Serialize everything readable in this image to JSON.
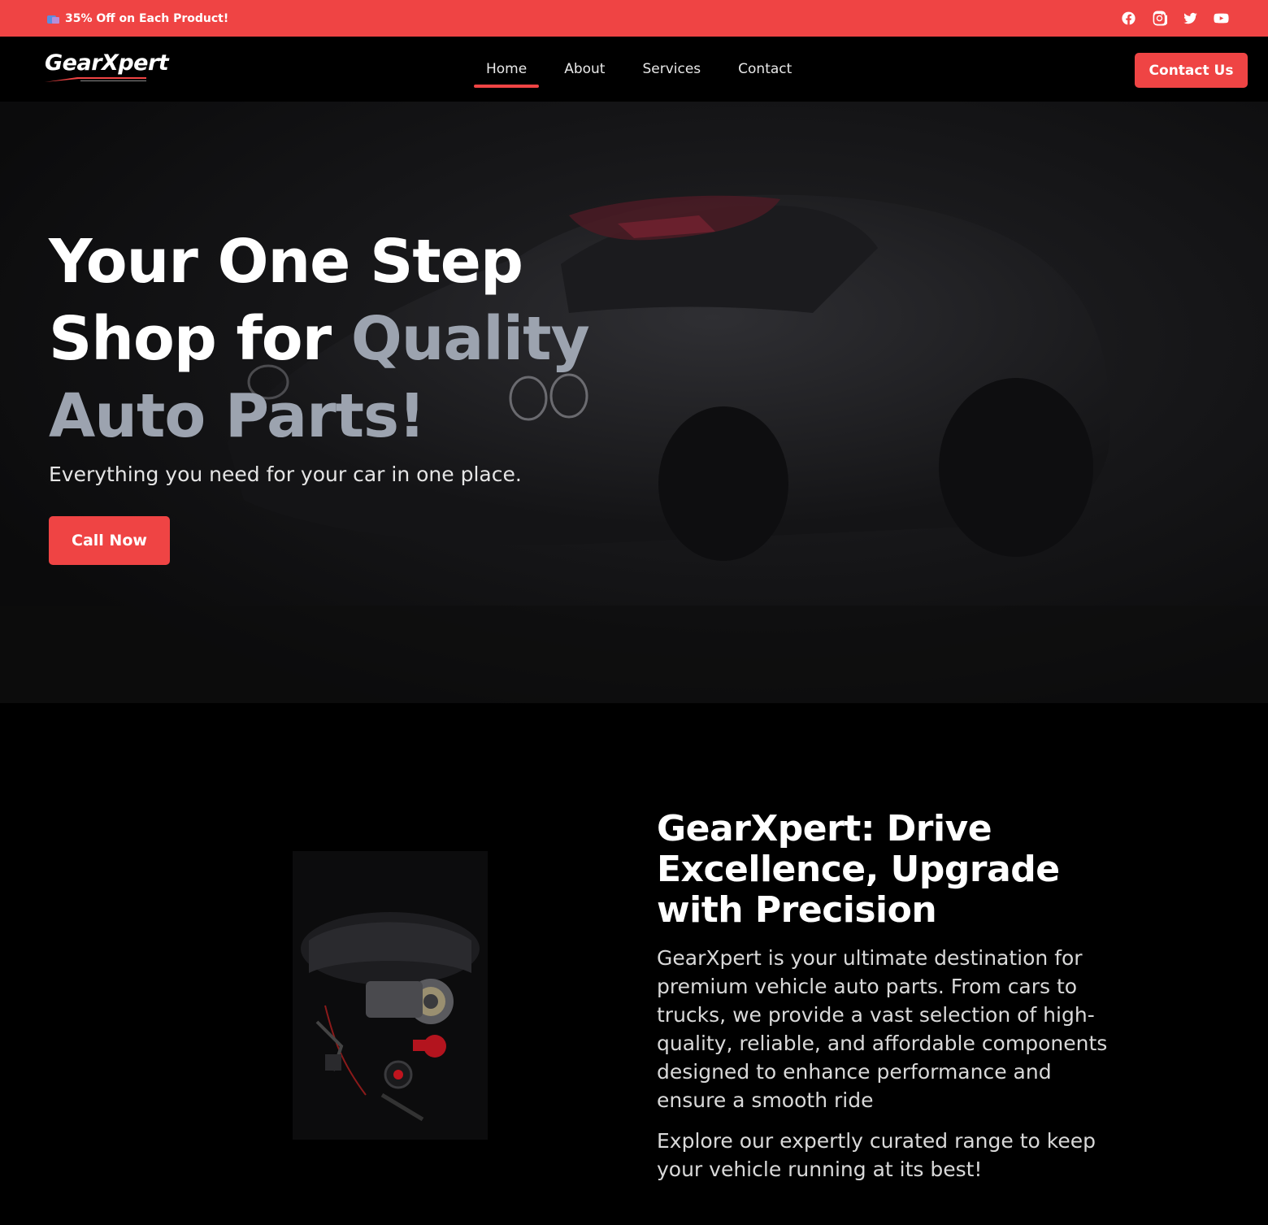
{
  "topbar": {
    "promo_text": "35% Off on Each Product!",
    "promo_icon": "shopping-bags-icon",
    "socials": [
      {
        "name": "facebook-icon"
      },
      {
        "name": "instagram-icon"
      },
      {
        "name": "twitter-icon"
      },
      {
        "name": "youtube-icon"
      }
    ]
  },
  "navbar": {
    "logo": "GearXpert",
    "items": [
      {
        "label": "Home",
        "active": true
      },
      {
        "label": "About"
      },
      {
        "label": "Services"
      },
      {
        "label": "Contact"
      }
    ],
    "cta_label": "Contact Us"
  },
  "hero": {
    "title_part1": "Your One Step Shop for",
    "title_accent": "Quality Auto Parts!",
    "subtitle": "Everything you need for your car in one place.",
    "button_label": "Call Now"
  },
  "about": {
    "title": "GearXpert: Drive Excellence, Upgrade with Precision",
    "paragraph1": "GearXpert is your ultimate destination for premium vehicle auto parts. From cars to trucks, we provide a vast selection of high-quality, reliable, and affordable components designed to enhance performance and ensure a smooth ride",
    "paragraph2": "Explore our expertly curated range to keep your vehicle running at its best!"
  },
  "colors": {
    "accent": "#ef4444",
    "accent_text": "#9ca3af",
    "background": "#000000"
  }
}
